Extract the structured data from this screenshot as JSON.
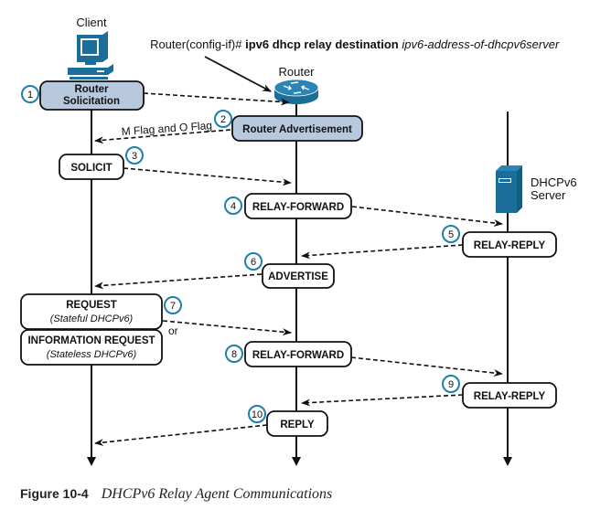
{
  "colors": {
    "device_blue": "#1a6e99",
    "step_circle": "#1f7fae",
    "highlight_box": "#b9c9dd",
    "line": "#111111"
  },
  "entities": {
    "client": "Client",
    "router": "Router",
    "server_line1": "DHCPv6",
    "server_line2": "Server"
  },
  "command": {
    "prefix": "Router(config-if)# ",
    "keyword": "ipv6 dhcp relay destination",
    "argument": " ipv6-address-of-dhcpv6server"
  },
  "steps": [
    {
      "num": "1",
      "line1": "Router",
      "line2": "Solicitation"
    },
    {
      "num": "2",
      "label": "Router Advertisement",
      "annotation": "M Flag and O Flag"
    },
    {
      "num": "3",
      "label": "SOLICIT"
    },
    {
      "num": "4",
      "label": "RELAY-FORWARD"
    },
    {
      "num": "5",
      "label": "RELAY-REPLY"
    },
    {
      "num": "6",
      "label": "ADVERTISE"
    },
    {
      "num": "7",
      "label": "REQUEST",
      "sub": "(Stateful DHCPv6)",
      "or": "or",
      "alt_label": "INFORMATION REQUEST",
      "alt_sub": "(Stateless DHCPv6)"
    },
    {
      "num": "8",
      "label": "RELAY-FORWARD"
    },
    {
      "num": "9",
      "label": "RELAY-REPLY"
    },
    {
      "num": "10",
      "label": "REPLY"
    }
  ],
  "caption": {
    "label": "Figure 10-4",
    "title": "DHCPv6 Relay Agent Communications"
  }
}
